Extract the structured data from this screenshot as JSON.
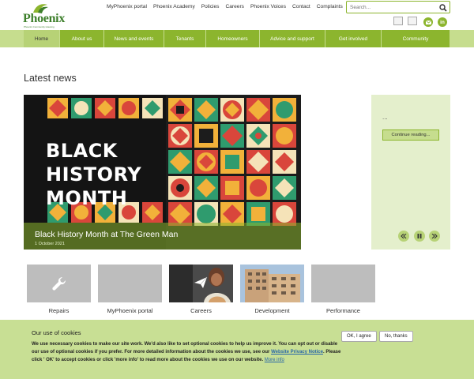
{
  "brand": {
    "name": "Phoenix",
    "tagline": "Phoenix Community Housing"
  },
  "top_links": [
    "MyPhoenix portal",
    "Phoenix Academy",
    "Policies",
    "Careers",
    "Phoenix Voices",
    "Contact",
    "Complaints"
  ],
  "search": {
    "placeholder": "Search..."
  },
  "nav": {
    "items": [
      {
        "label": "Home",
        "active": true
      },
      {
        "label": "About us"
      },
      {
        "label": "News and events"
      },
      {
        "label": "Tenants"
      },
      {
        "label": "Homeowners"
      },
      {
        "label": "Advice and support"
      },
      {
        "label": "Get involved"
      },
      {
        "label": "Community"
      }
    ]
  },
  "news": {
    "heading": "Latest news",
    "hero_graphic_text": [
      "BLACK",
      "HISTORY",
      "MONTH"
    ],
    "caption_title": "Black History Month at The Green Man",
    "caption_date": "1 October 2021",
    "side_ellipsis": "...",
    "continue_label": "Continue reading..."
  },
  "tiles": [
    {
      "label": "Repairs",
      "icon": "wrench-icon"
    },
    {
      "label": "MyPhoenix portal"
    },
    {
      "label": "Careers",
      "icon": "paper-plane-icon"
    },
    {
      "label": "Development"
    },
    {
      "label": "Performance"
    }
  ],
  "cookie": {
    "title": "Our use of cookies",
    "body_1": "We use necessary cookies to make our site work. We'd also like to set optional cookies to help us improve it. You can opt out or disable our use of optional cookies if you prefer. For more detailed information about the cookies we use, see our ",
    "link": "Website Privacy Notice",
    "body_2": ". Please click ' OK' to accept cookies or click 'more info' to read more about the cookies we use on our website. ",
    "more_info": "More info",
    "accept_label": "OK, I agree",
    "decline_label": "No, thanks"
  },
  "colors": {
    "accent": "#8cb52e",
    "accent_light": "#c6dd8e",
    "panel": "#e4efcc",
    "cookie_bg": "#c8df94",
    "link": "#2766a8"
  }
}
